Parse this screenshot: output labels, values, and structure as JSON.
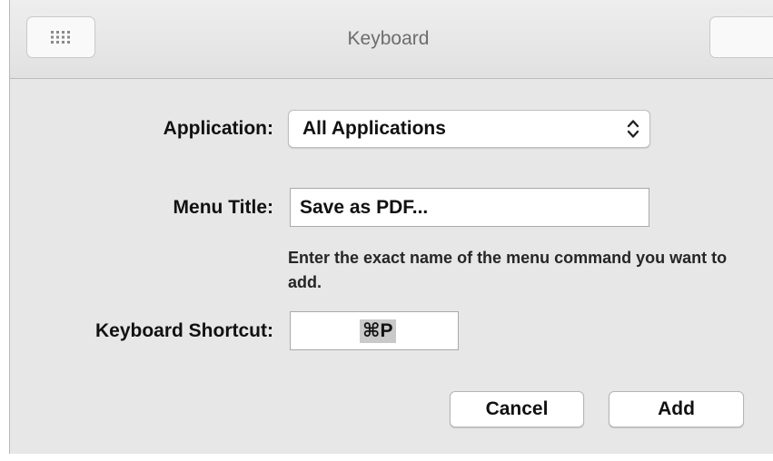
{
  "window": {
    "title": "Keyboard",
    "toolbar_icons": [
      "grid-dots-icon"
    ]
  },
  "form": {
    "application": {
      "label": "Application:",
      "value": "All Applications"
    },
    "menu_title": {
      "label": "Menu Title:",
      "value": "Save as PDF...",
      "help": "Enter the exact name of the menu command you want to add."
    },
    "keyboard_shortcut": {
      "label": "Keyboard Shortcut:",
      "value": "⌘P"
    }
  },
  "buttons": {
    "cancel": "Cancel",
    "add": "Add"
  }
}
